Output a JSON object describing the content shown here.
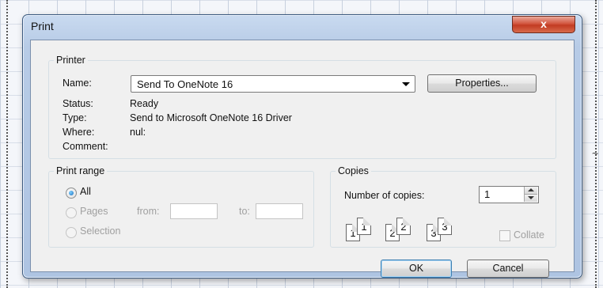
{
  "window": {
    "title": "Print",
    "close_glyph": "x"
  },
  "printer": {
    "legend": "Printer",
    "name_label": "Name:",
    "name_value": "Send To OneNote 16",
    "properties_label": "Properties...",
    "status_label": "Status:",
    "status_value": "Ready",
    "type_label": "Type:",
    "type_value": "Send to Microsoft OneNote 16 Driver",
    "where_label": "Where:",
    "where_value": "nul:",
    "comment_label": "Comment:",
    "comment_value": ""
  },
  "print_range": {
    "legend": "Print range",
    "all_label": "All",
    "pages_label": "Pages",
    "from_label": "from:",
    "from_value": "",
    "to_label": "to:",
    "to_value": "",
    "selection_label": "Selection",
    "selected": "All"
  },
  "copies": {
    "legend": "Copies",
    "number_label": "Number of copies:",
    "number_value": "1",
    "collate_label": "Collate",
    "collate_checked": false,
    "preview_pages": [
      "1",
      "1",
      "2",
      "2",
      "3",
      "3"
    ]
  },
  "buttons": {
    "ok": "OK",
    "cancel": "Cancel"
  }
}
